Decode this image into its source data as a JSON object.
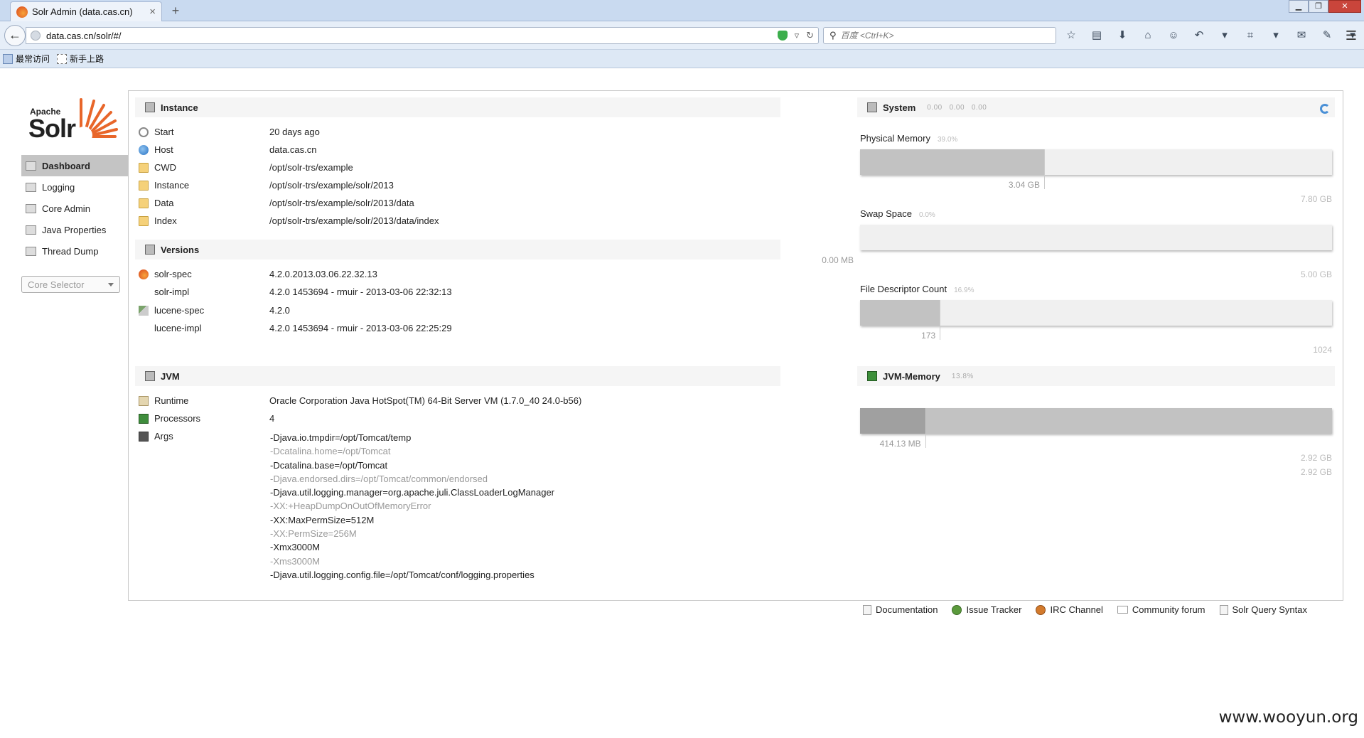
{
  "browser": {
    "tab_title": "Solr Admin (data.cas.cn)",
    "url": "data.cas.cn/solr/#/",
    "search_placeholder": "百度 <Ctrl+K>",
    "bookmarks": [
      "最常访问",
      "新手上路"
    ]
  },
  "logo": {
    "apache": "Apache",
    "solr": "Solr"
  },
  "sidebar": {
    "items": [
      {
        "label": "Dashboard",
        "active": true
      },
      {
        "label": "Logging"
      },
      {
        "label": "Core Admin"
      },
      {
        "label": "Java Properties"
      },
      {
        "label": "Thread Dump"
      }
    ],
    "core_selector": "Core Selector"
  },
  "instance": {
    "title": "Instance",
    "rows": [
      {
        "label": "Start",
        "value": "20 days ago",
        "icon": "clock-icon"
      },
      {
        "label": "Host",
        "value": "data.cas.cn",
        "icon": "globe-icon"
      },
      {
        "label": "CWD",
        "value": "/opt/solr-trs/example",
        "icon": "folder-icon"
      },
      {
        "label": "Instance",
        "value": "/opt/solr-trs/example/solr/2013",
        "icon": "folder-icon"
      },
      {
        "label": "Data",
        "value": "/opt/solr-trs/example/solr/2013/data",
        "icon": "folder-icon"
      },
      {
        "label": "Index",
        "value": "/opt/solr-trs/example/solr/2013/data/index",
        "icon": "folder-icon"
      }
    ]
  },
  "versions": {
    "title": "Versions",
    "rows": [
      {
        "label": "solr-spec",
        "value": "4.2.0.2013.03.06.22.32.13"
      },
      {
        "label": "solr-impl",
        "value": "4.2.0 1453694 - rmuir - 2013-03-06 22:32:13"
      },
      {
        "label": "lucene-spec",
        "value": "4.2.0"
      },
      {
        "label": "lucene-impl",
        "value": "4.2.0 1453694 - rmuir - 2013-03-06 22:25:29"
      }
    ]
  },
  "jvm": {
    "title": "JVM",
    "runtime_label": "Runtime",
    "runtime": "Oracle Corporation Java HotSpot(TM) 64-Bit Server VM (1.7.0_40 24.0-b56)",
    "processors_label": "Processors",
    "processors": "4",
    "args_label": "Args",
    "args": [
      "-Djava.io.tmpdir=/opt/Tomcat/temp",
      "-Dcatalina.home=/opt/Tomcat",
      "-Dcatalina.base=/opt/Tomcat",
      "-Djava.endorsed.dirs=/opt/Tomcat/common/endorsed",
      "-Djava.util.logging.manager=org.apache.juli.ClassLoaderLogManager",
      "-XX:+HeapDumpOnOutOfMemoryError",
      "-XX:MaxPermSize=512M",
      "-XX:PermSize=256M",
      "-Xmx3000M",
      "-Xms3000M",
      "-Djava.util.logging.config.file=/opt/Tomcat/conf/logging.properties"
    ]
  },
  "system": {
    "title": "System",
    "load": [
      "0.00",
      "0.00",
      "0.00"
    ],
    "physical_memory": {
      "label": "Physical Memory",
      "pct": "39.0%",
      "fraction": 0.39,
      "used": "3.04 GB",
      "total": "7.80 GB"
    },
    "swap": {
      "label": "Swap Space",
      "pct": "0.0%",
      "fraction": 0.0,
      "used": "0.00 MB",
      "total": "5.00 GB"
    },
    "fd": {
      "label": "File Descriptor Count",
      "pct": "16.9%",
      "fraction": 0.169,
      "used": "173",
      "total": "1024"
    }
  },
  "jvm_memory": {
    "title": "JVM-Memory",
    "pct": "13.8%",
    "used": "414.13 MB",
    "used_fraction": 0.138,
    "committed_fraction": 1.0,
    "committed": "2.92 GB",
    "max": "2.92 GB"
  },
  "footer": {
    "links": [
      "Documentation",
      "Issue Tracker",
      "IRC Channel",
      "Community forum",
      "Solr Query Syntax"
    ]
  },
  "watermark": "www.wooyun.org",
  "colors": {
    "accent": "#4a90d6",
    "bar_fill": "#c2c2c2",
    "bar_track": "#f0f0f0"
  }
}
